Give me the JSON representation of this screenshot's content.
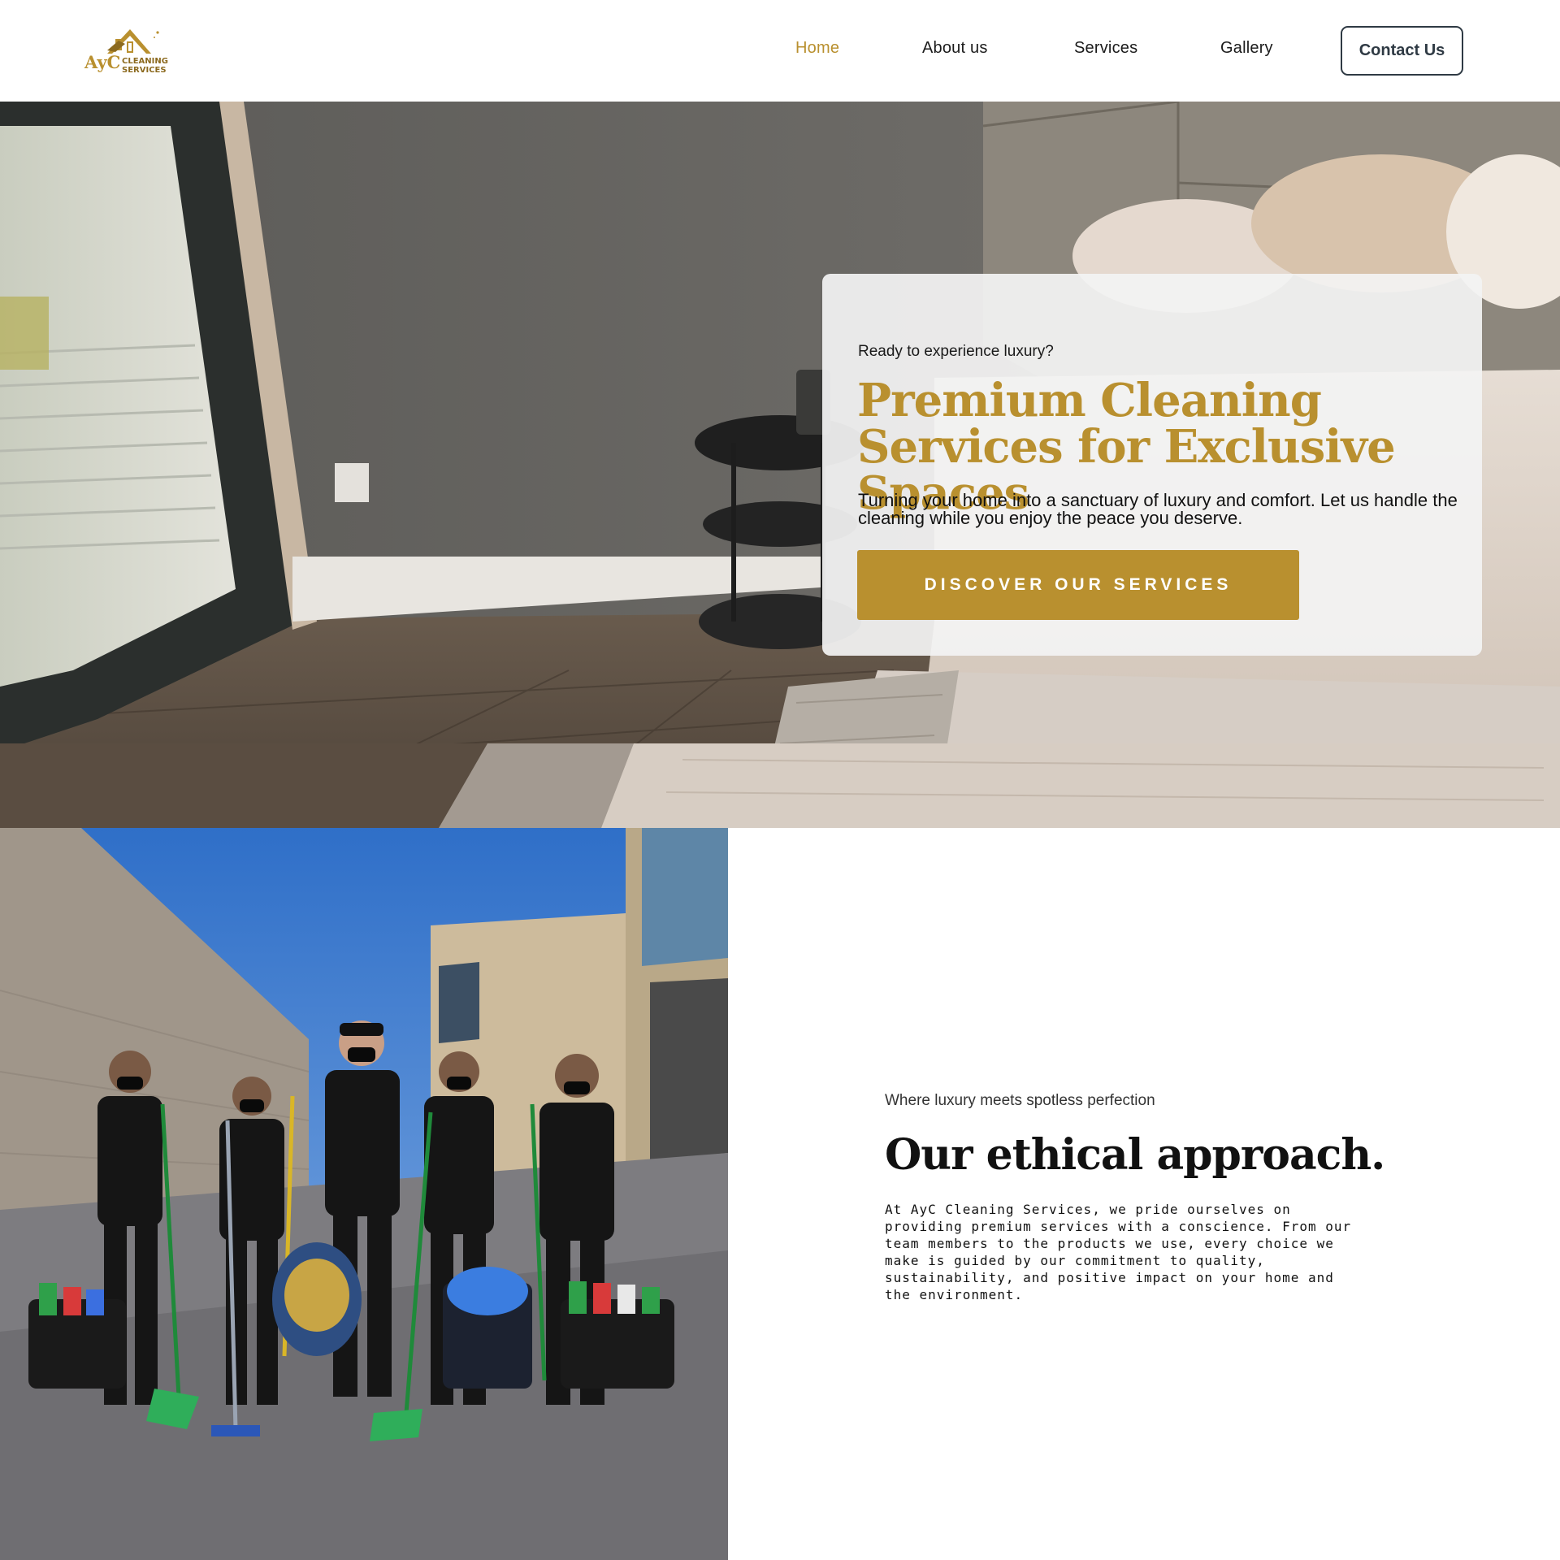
{
  "brand": {
    "logo_text_main": "AyC",
    "logo_text_line1": "CLEANING",
    "logo_text_line2": "SERVICES",
    "accent_color": "#b9902f"
  },
  "nav": {
    "items": [
      {
        "label": "Home",
        "active": true
      },
      {
        "label": "About us",
        "active": false
      },
      {
        "label": "Services",
        "active": false
      },
      {
        "label": "Gallery",
        "active": false
      }
    ],
    "contact_label": "Contact Us"
  },
  "hero": {
    "eyebrow": "Ready to experience luxury?",
    "title": "Premium Cleaning Services for Exclusive Spaces",
    "subtitle": "Turning your home into a sanctuary of luxury and comfort. Let us handle the cleaning while you enjoy the peace you deserve.",
    "cta_label": "DISCOVER OUR SERVICES"
  },
  "about": {
    "eyebrow": "Where luxury meets spotless perfection",
    "title": "Our ethical approach.",
    "body": "At AyC Cleaning Services, we pride ourselves on providing premium services with a conscience. From our team members to the products we use, every choice we make is guided by our commitment to quality, sustainability, and positive impact on your home and the environment."
  }
}
